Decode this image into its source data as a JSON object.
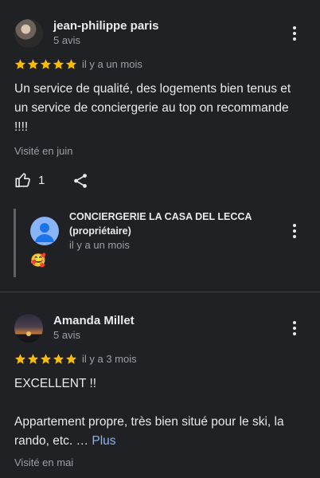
{
  "reviews": [
    {
      "author": "jean-philippe paris",
      "reviews_count": "5 avis",
      "rating": 5,
      "time": "il y a un mois",
      "text_lines": [
        "Un service de qualité, des logements bien tenus et",
        "un service de conciergerie au top on recommande",
        "!!!!"
      ],
      "visited": "Visité en juin",
      "likes": "1",
      "owner_reply": {
        "name_line1": "CONCIERGERIE LA CASA DEL LECCA",
        "name_line2": "(propriétaire)",
        "time": "il y a un mois",
        "emoji": "🥰"
      }
    },
    {
      "author": "Amanda Millet",
      "reviews_count": "5 avis",
      "rating": 5,
      "time": "il y a 3 mois",
      "text_line1": "EXCELLENT !!",
      "text_line2": "Appartement propre, très bien situé pour le ski, la",
      "text_line3": "rando, etc. … ",
      "more_label": "Plus",
      "visited": "Visité en mai"
    }
  ],
  "colors": {
    "background": "#202124",
    "star": "#fbbc04",
    "link": "#8ab4f8",
    "secondary_text": "#9aa0a6"
  },
  "icons": [
    "more-vert-icon",
    "star-icon",
    "thumb-up-icon",
    "share-icon",
    "person-icon"
  ]
}
